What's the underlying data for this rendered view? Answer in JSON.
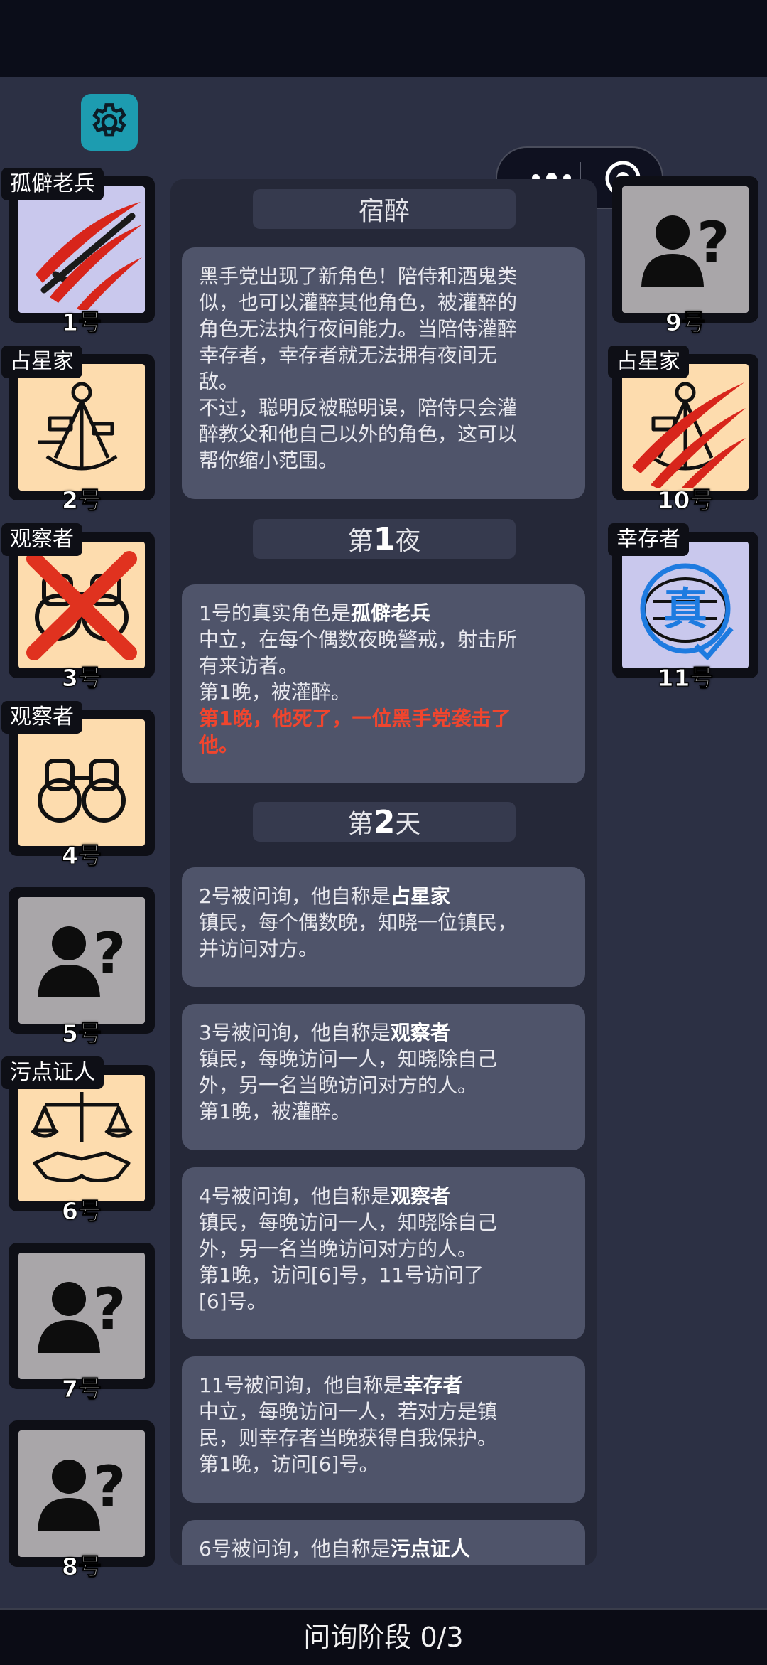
{
  "settings_icon": "gear-icon",
  "capsule": {
    "more_icon": "more-dots-icon",
    "close_icon": "target-close-icon"
  },
  "left_players": [
    {
      "role": "孤僻老兵",
      "number": "1号",
      "icon": "rifle-icon",
      "card_color": "#c9c8ed",
      "mark": "scratch"
    },
    {
      "role": "占星家",
      "number": "2号",
      "icon": "sextant-icon",
      "card_color": "#fddcae",
      "mark": ""
    },
    {
      "role": "观察者",
      "number": "3号",
      "icon": "binoculars-icon",
      "card_color": "#fddcae",
      "mark": "cross"
    },
    {
      "role": "观察者",
      "number": "4号",
      "icon": "binoculars-icon",
      "card_color": "#fddcae",
      "mark": ""
    },
    {
      "role": "",
      "number": "5号",
      "icon": "unknown-person-icon",
      "card_color": "#a9a6a9",
      "mark": ""
    },
    {
      "role": "污点证人",
      "number": "6号",
      "icon": "scales-handshake-icon",
      "card_color": "#fddcae",
      "mark": ""
    },
    {
      "role": "",
      "number": "7号",
      "icon": "unknown-person-icon",
      "card_color": "#a9a6a9",
      "mark": ""
    },
    {
      "role": "",
      "number": "8号",
      "icon": "unknown-person-icon",
      "card_color": "#a9a6a9",
      "mark": ""
    }
  ],
  "right_players": [
    {
      "role": "",
      "number": "9号",
      "icon": "unknown-person-icon",
      "card_color": "#a9a6a9",
      "mark": ""
    },
    {
      "role": "占星家",
      "number": "10号",
      "icon": "sextant-icon",
      "card_color": "#fddcae",
      "mark": "scratch"
    },
    {
      "role": "幸存者",
      "number": "11号",
      "icon": "turtle-shield-icon",
      "card_color": "#c9c8ed",
      "mark": "",
      "stamp": "真"
    }
  ],
  "log": {
    "h1": "宿醉",
    "m1": {
      "l1": "黑手党出现了新角色！陪侍和酒鬼类",
      "l2": "似，也可以灌醉其他角色，被灌醉的",
      "l3": "角色无法执行夜间能力。当陪侍灌醉",
      "l4": "幸存者，幸存者就无法拥有夜间无",
      "l5": "敌。",
      "l6": "不过，聪明反被聪明误，陪侍只会灌",
      "l7": "醉教父和他自己以外的角色，这可以",
      "l8": "帮你缩小范围。"
    },
    "h2": {
      "pre": "第",
      "num": "1",
      "post": "夜"
    },
    "m2": {
      "l1_pre": "1号的真实角色是",
      "l1_bold": "孤僻老兵",
      "l2": "中立，在每个偶数夜晚警戒，射击所",
      "l3": "有来访者。",
      "l4": "第1晚，被灌醉。",
      "l5": "第1晚，他死了，一位黑手党袭击了",
      "l6": "他。"
    },
    "h3": {
      "pre": "第",
      "num": "2",
      "post": "天"
    },
    "m3": {
      "l1_pre": "2号被问询，他自称是",
      "l1_bold": "占星家",
      "l2": "镇民，每个偶数晚，知晓一位镇民，",
      "l3": "并访问对方。"
    },
    "m4": {
      "l1_pre": "3号被问询，他自称是",
      "l1_bold": "观察者",
      "l2": "镇民，每晚访问一人，知晓除自己",
      "l3": "外，另一名当晚访问对方的人。",
      "l4": "第1晚，被灌醉。"
    },
    "m5": {
      "l1_pre": "4号被问询，他自称是",
      "l1_bold": "观察者",
      "l2": "镇民，每晚访问一人，知晓除自己",
      "l3": "外，另一名当晚访问对方的人。",
      "l4": "第1晚，访问[6]号，11号访问了",
      "l5": "[6]号。"
    },
    "m6": {
      "l1_pre": "11号被问询，他自称是",
      "l1_bold": "幸存者",
      "l2": "中立，每晚访问一人，若对方是镇",
      "l3": "民，则幸存者当晚获得自我保护。",
      "l4": "第1晚，访问[6]号。"
    },
    "m7": {
      "l1_pre": "6号被问询，他自称是",
      "l1_bold": "污点证人"
    }
  },
  "footer": {
    "status": "问询阶段 0/3"
  },
  "colors": {
    "background": "#2c3044",
    "message_bg": "#4f546a",
    "header_bg": "#363a4e",
    "alert_red": "#f0452e"
  }
}
